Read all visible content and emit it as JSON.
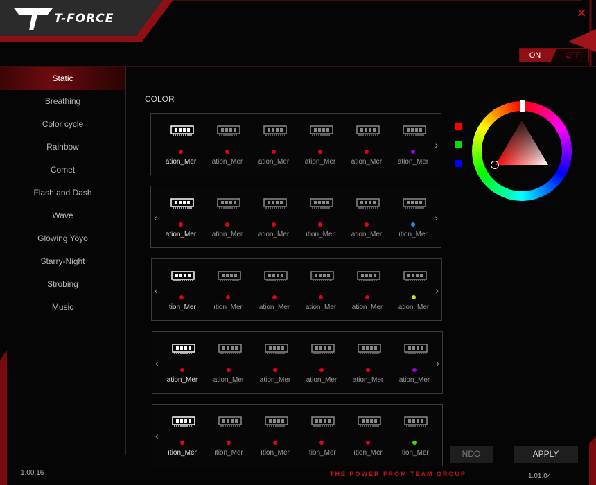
{
  "app": {
    "logo_text": "T-FORCE",
    "close_icon": "close-icon",
    "accent_color": "#c1161d"
  },
  "power": {
    "on_label": "ON",
    "off_label": "OFF",
    "state": "ON"
  },
  "sidebar": {
    "items": [
      {
        "label": "Static",
        "active": true
      },
      {
        "label": "Breathing",
        "active": false
      },
      {
        "label": "Color cycle",
        "active": false
      },
      {
        "label": "Rainbow",
        "active": false
      },
      {
        "label": "Comet",
        "active": false
      },
      {
        "label": "Flash and Dash",
        "active": false
      },
      {
        "label": "Wave",
        "active": false
      },
      {
        "label": "Glowing Yoyo",
        "active": false
      },
      {
        "label": "Starry-Night",
        "active": false
      },
      {
        "label": "Strobing",
        "active": false
      },
      {
        "label": "Music",
        "active": false
      }
    ]
  },
  "main": {
    "color_label": "COLOR",
    "groups": [
      {
        "prev_arrow": false,
        "next_arrow": true,
        "modules": [
          {
            "label": "ation_Mer",
            "dot": "#e5001a"
          },
          {
            "label": "ation_Mer",
            "dot": "#e5001a"
          },
          {
            "label": "ation_Mer",
            "dot": "#e5001a"
          },
          {
            "label": "ation_Mer",
            "dot": "#e5001a"
          },
          {
            "label": "ation_Mer",
            "dot": "#e5001a"
          },
          {
            "label": "ation_Mer",
            "dot": "#a200e0"
          }
        ]
      },
      {
        "prev_arrow": true,
        "next_arrow": true,
        "modules": [
          {
            "label": "ation_Mer",
            "dot": "#e5001a"
          },
          {
            "label": "ation_Mer",
            "dot": "#e5001a"
          },
          {
            "label": "ation_Mer",
            "dot": "#e5001a"
          },
          {
            "label": "ıtion_Mer",
            "dot": "#e5001a"
          },
          {
            "label": "ation_Mer",
            "dot": "#e5001a"
          },
          {
            "label": "ıtion_Mer",
            "dot": "#1a8fe8"
          }
        ]
      },
      {
        "prev_arrow": true,
        "next_arrow": true,
        "modules": [
          {
            "label": "ıtion_Mer",
            "dot": "#e5001a"
          },
          {
            "label": "ıtion_Mer",
            "dot": "#e5001a"
          },
          {
            "label": "ation_Mer",
            "dot": "#e5001a"
          },
          {
            "label": "ation_Mer",
            "dot": "#e5001a"
          },
          {
            "label": "ation_Mer",
            "dot": "#e5001a"
          },
          {
            "label": "ation_Mer",
            "dot": "#d4e600"
          }
        ]
      },
      {
        "prev_arrow": true,
        "next_arrow": true,
        "modules": [
          {
            "label": "ation_Mer",
            "dot": "#e5001a"
          },
          {
            "label": "ation_Mer",
            "dot": "#e5001a"
          },
          {
            "label": "ation_Mer",
            "dot": "#e5001a"
          },
          {
            "label": "ation_Mer",
            "dot": "#e5001a"
          },
          {
            "label": "ation_Mer",
            "dot": "#e5001a"
          },
          {
            "label": "ation_Mer",
            "dot": "#a200e0"
          }
        ]
      },
      {
        "prev_arrow": true,
        "next_arrow": false,
        "modules": [
          {
            "label": "ıtion_Mer",
            "dot": "#e5001a"
          },
          {
            "label": "ıtion_Mer",
            "dot": "#e5001a"
          },
          {
            "label": "ıtion_Mer",
            "dot": "#e5001a"
          },
          {
            "label": "ıtion_Mer",
            "dot": "#e5001a"
          },
          {
            "label": "ıtion_Mer",
            "dot": "#e5001a"
          },
          {
            "label": "ıtion_Mer",
            "dot": "#3fe000"
          }
        ]
      }
    ]
  },
  "swatches": [
    "#ff0000",
    "#00e000",
    "#0000ff"
  ],
  "buttons": {
    "undo_label": "NDO",
    "apply_label": "APPLY"
  },
  "footer": {
    "version_left": "1.00.16",
    "version_right": "1.01.04",
    "tagline": "THE POWER FROM TEAM GROUP"
  }
}
